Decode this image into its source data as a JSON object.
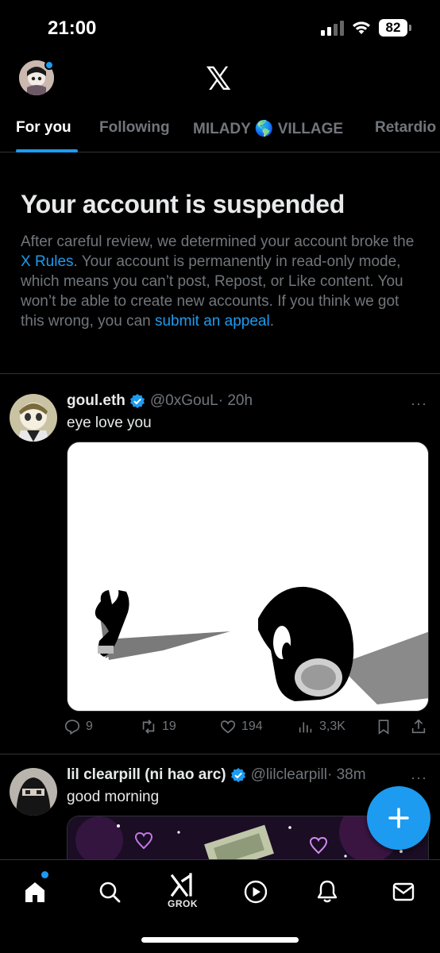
{
  "status_bar": {
    "time": "21:00",
    "battery": "82"
  },
  "header": {
    "logo": "𝕏",
    "tabs": [
      {
        "label": "For you",
        "active": true
      },
      {
        "label": "Following"
      },
      {
        "label": "MILADY 🌎 VILLAGE"
      },
      {
        "label": "Retardio"
      }
    ]
  },
  "notice": {
    "title": "Your account is suspended",
    "body_1": "After careful review, we determined your account broke the ",
    "link_rules": "X Rules",
    "body_2": ". Your account is permanently in read-only mode, which means you can’t post, Repost, or Like content. You won’t be able to create new accounts. If you think we got this wrong, you can ",
    "link_appeal": "submit an appeal",
    "body_3": "."
  },
  "posts": [
    {
      "name": "goul.eth",
      "handle": "@0xGouL",
      "time": "· 20h",
      "text": "eye love you",
      "more": "···",
      "replies": "9",
      "reposts": "19",
      "likes": "194",
      "views": "3,3K"
    },
    {
      "name": "lil clearpill (ni hao arc)",
      "handle": "@lilclearpill",
      "time": "· 38m",
      "text": "good morning",
      "more": "···"
    }
  ],
  "bottom_nav": {
    "items": [
      "home-icon",
      "search-icon",
      "grok-icon",
      "video-icon",
      "notifications-icon",
      "messages-icon"
    ],
    "grok_label": "GROK"
  },
  "colors": {
    "accent": "#1d9bf0",
    "muted": "#71767b",
    "text": "#e7e9ea",
    "background": "#000000"
  }
}
